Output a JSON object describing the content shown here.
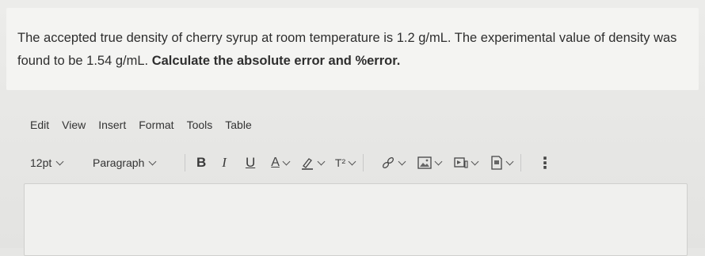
{
  "question": {
    "text_regular": "The accepted true density of cherry syrup at room temperature is 1.2 g/mL. The experimental value of density was found to be 1.54 g/mL. ",
    "text_bold": "Calculate the absolute error and %error."
  },
  "menu": {
    "items": [
      "Edit",
      "View",
      "Insert",
      "Format",
      "Tools",
      "Table"
    ]
  },
  "toolbar": {
    "font_size": "12pt",
    "block_format": "Paragraph",
    "bold_label": "B",
    "italic_label": "I",
    "underline_label": "U",
    "text_color_label": "A",
    "superscript_label": "T²",
    "more_label": "⋮"
  },
  "editor": {
    "content": ""
  }
}
